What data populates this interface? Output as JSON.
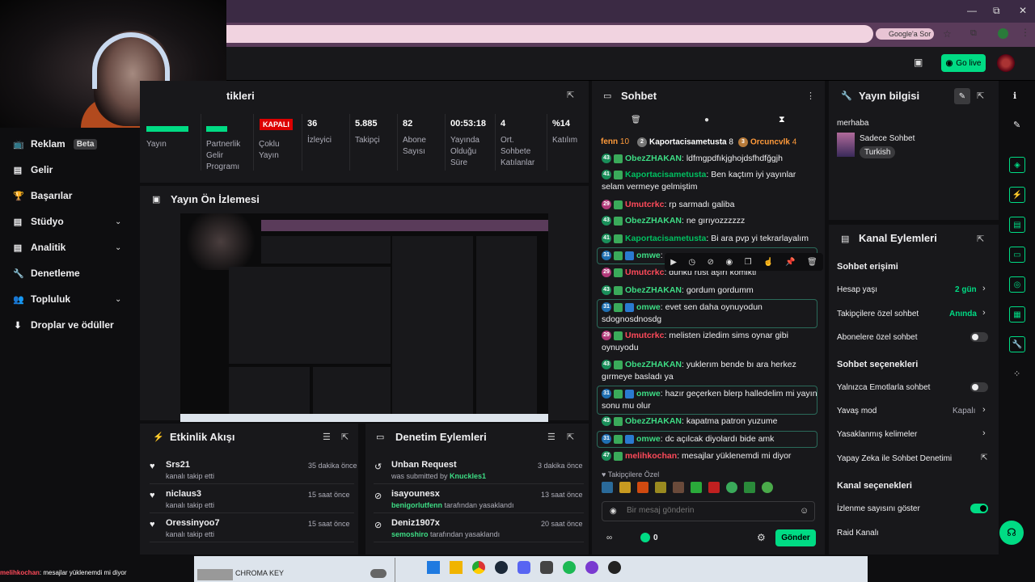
{
  "browser": {
    "search_hint": "Google'a Sor",
    "win": [
      "—",
      "⧉",
      "✕"
    ]
  },
  "topbar": {
    "golive": "Go live"
  },
  "sidebar": {
    "items": [
      {
        "label": "Reklam",
        "badge": "Beta",
        "icon": "📺"
      },
      {
        "label": "Gelir",
        "icon": "▤"
      },
      {
        "label": "Başarılar",
        "icon": "🏆"
      },
      {
        "label": "Stüdyo",
        "icon": "▤",
        "chevron": true
      },
      {
        "label": "Analitik",
        "icon": "▤",
        "chevron": true
      },
      {
        "label": "Denetleme",
        "icon": "🔧"
      },
      {
        "label": "Topluluk",
        "icon": "👥",
        "chevron": true
      },
      {
        "label": "Droplar ve ödüller",
        "icon": "⬇"
      }
    ]
  },
  "stats": {
    "title": "tikleri",
    "items": [
      {
        "value": "",
        "label": "Yayın"
      },
      {
        "value": "",
        "label": "Partnerlik Gelir Programı"
      },
      {
        "value": "KAPALI",
        "label": "Çoklu Yayın"
      },
      {
        "value": "36",
        "label": "İzleyici"
      },
      {
        "value": "5.885",
        "label": "Takipçi"
      },
      {
        "value": "82",
        "label": "Abone Sayısı"
      },
      {
        "value": "00:53:18",
        "label": "Yayında Olduğu Süre"
      },
      {
        "value": "4",
        "label": "Ort. Sohbete Katılanlar"
      },
      {
        "value": "%14",
        "label": "Katılım"
      }
    ]
  },
  "preview": {
    "title": "Yayın Ön İzlemesi"
  },
  "activity": {
    "title": "Etkinlik Akışı",
    "items": [
      {
        "name": "Srs21",
        "sub": "kanalı takip etti",
        "time": "35 dakika önce"
      },
      {
        "name": "niclaus3",
        "sub": "kanalı takip etti",
        "time": "15 saat önce"
      },
      {
        "name": "Oressinyoo7",
        "sub": "kanalı takip etti",
        "time": "15 saat önce"
      }
    ]
  },
  "modactions": {
    "title": "Denetim Eylemleri",
    "items": [
      {
        "name": "Unban Request",
        "sub_pre": "was submitted by ",
        "sub_user": "Knuckles1",
        "time": "3 dakika önce"
      },
      {
        "name": "isayounesx",
        "sub_pre": "",
        "sub_user": "benigorlutfenn",
        "sub_post": " tarafından yasaklandı",
        "time": "13 saat önce"
      },
      {
        "name": "Deniz1907x",
        "sub_pre": "",
        "sub_user": "semoshiro",
        "sub_post": " tarafından yasaklandı",
        "time": "20 saat önce"
      }
    ]
  },
  "chat": {
    "title": "Sohbet",
    "topbar": [
      {
        "user": "fenn",
        "count": "10"
      },
      {
        "user": "Kaportacisametusta",
        "count": "8",
        "rank": "2"
      },
      {
        "user": "Orcuncvlk",
        "count": "4",
        "rank": "3"
      }
    ],
    "messages": [
      {
        "badge": "43",
        "bc": "b-green",
        "user": "ObezZHAKAN",
        "uc": "#3ddc84",
        "text": "ldfmgpdfıkjghojdsfhdfğgjh",
        "hl": false
      },
      {
        "badge": "41",
        "bc": "b-green",
        "user": "Kaportacisametusta",
        "uc": "#00c060",
        "text": "Ben kaçtım iyi yayınlar selam vermeye gelmiştim",
        "hl": false
      },
      {
        "badge": "29",
        "bc": "b-pink",
        "user": "Umutcrkc",
        "uc": "#ff4a5a",
        "text": "rp sarmadı galiba",
        "hl": false
      },
      {
        "badge": "43",
        "bc": "b-green",
        "user": "ObezZHAKAN",
        "uc": "#3ddc84",
        "text": "ne gırıyozzzzzz",
        "hl": false
      },
      {
        "badge": "41",
        "bc": "b-green",
        "user": "Kaportacisametusta",
        "uc": "#00c060",
        "text": "Bi ara pvp yi tekrarlayalım",
        "hl": false
      },
      {
        "badge": "31",
        "bc": "b-blue",
        "user": "omwe",
        "uc": "#3ddc84",
        "text": "",
        "hl": true
      },
      {
        "badge": "29",
        "bc": "b-pink",
        "user": "Umutcrkc",
        "uc": "#ff4a5a",
        "text": "dunku rust aşırı komikti",
        "hl": false
      },
      {
        "badge": "43",
        "bc": "b-green",
        "user": "ObezZHAKAN",
        "uc": "#3ddc84",
        "text": "gordum gordumm",
        "hl": false
      },
      {
        "badge": "31",
        "bc": "b-blue",
        "user": "omwe",
        "uc": "#3ddc84",
        "text": "evet sen daha oynuyodun sdognosdnosdg",
        "hl": true
      },
      {
        "badge": "29",
        "bc": "b-pink",
        "user": "Umutcrkc",
        "uc": "#ff4a5a",
        "text": "melisten izledim sims oynar gibi oynuyodu",
        "hl": false
      },
      {
        "badge": "43",
        "bc": "b-green",
        "user": "ObezZHAKAN",
        "uc": "#3ddc84",
        "text": "yuklerım bende bı ara herkez gırmeye basladı ya",
        "hl": false
      },
      {
        "badge": "31",
        "bc": "b-blue",
        "user": "omwe",
        "uc": "#3ddc84",
        "text": "hazır geçerken blerp halledelim mi yayın sonu mu olur",
        "hl": true
      },
      {
        "badge": "43",
        "bc": "b-green",
        "user": "ObezZHAKAN",
        "uc": "#3ddc84",
        "text": "kapatma patron yuzume",
        "hl": false
      },
      {
        "badge": "31",
        "bc": "b-blue",
        "user": "omwe",
        "uc": "#3ddc84",
        "text": "dc açılcak diyolardı bide amk",
        "hl": true
      },
      {
        "badge": "47",
        "bc": "b-green",
        "user": "melihkochan",
        "uc": "#ff4a5a",
        "text": "mesajlar yüklenemdi mi diyor",
        "hl": false
      }
    ],
    "followers_only": "Takipçilere Özel",
    "placeholder": "Bir mesaj gönderin",
    "points": "0",
    "send": "Gönder"
  },
  "info": {
    "title": "Yayın bilgisi",
    "stream_title": "merhaba",
    "category": "Sadece Sohbet",
    "tag": "Turkish"
  },
  "channel": {
    "title": "Kanal Eylemleri",
    "sec1": "Sohbet erişimi",
    "age_label": "Hesap yaşı",
    "age_value": "2 gün",
    "followers_label": "Takipçilere özel sohbet",
    "followers_value": "Anında",
    "subs_label": "Abonelere özel sohbet",
    "sec2": "Sohbet seçenekleri",
    "emote_label": "Yalnızca Emotlarla sohbet",
    "slow_label": "Yavaş mod",
    "slow_value": "Kapalı",
    "banned_label": "Yasaklanmış kelimeler",
    "ai_label": "Yapay Zeka ile Sohbet Denetimi",
    "sec3": "Kanal seçenekleri",
    "viewer_label": "İzlenme sayısını göster",
    "raid_label": "Raid Kanalı"
  },
  "taskbar": {
    "chroma": "CHROMA KEY"
  },
  "overlay": {
    "user": "melihkochan",
    "text": ": mesajlar yüklenemdi mi diyor"
  }
}
